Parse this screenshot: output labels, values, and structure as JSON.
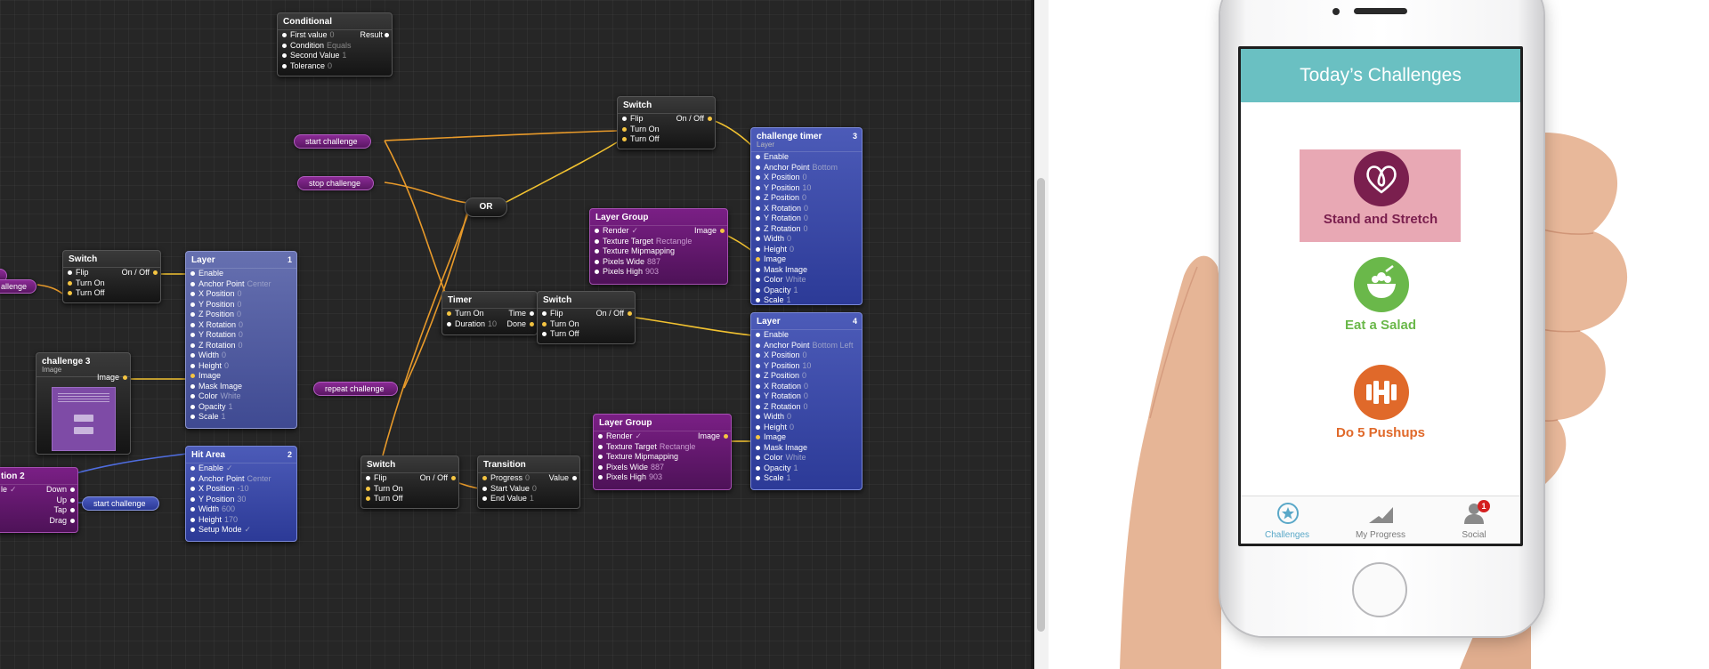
{
  "editor": {
    "nodes": {
      "conditional": {
        "title": "Conditional",
        "rows": [
          {
            "label": "First value",
            "value": "0"
          },
          {
            "label": "Condition",
            "value": "Equals"
          },
          {
            "label": "Second Value",
            "value": "1"
          },
          {
            "label": "Tolerance",
            "value": "0"
          }
        ],
        "output": "Result"
      },
      "switch_top": {
        "title": "Switch",
        "rows": [
          {
            "label": "Flip",
            "value": ""
          },
          {
            "label": "Turn On",
            "value": ""
          },
          {
            "label": "Turn Off",
            "value": ""
          }
        ],
        "output": "On / Off"
      },
      "challenge_timer": {
        "title": "challenge timer",
        "subtitle": "Layer",
        "index": "3",
        "rows": [
          {
            "label": "Enable",
            "value": ""
          },
          {
            "label": "Anchor Point",
            "value": "Bottom"
          },
          {
            "label": "X Position",
            "value": "0"
          },
          {
            "label": "Y Position",
            "value": "10"
          },
          {
            "label": "Z Position",
            "value": "0"
          },
          {
            "label": "X Rotation",
            "value": "0"
          },
          {
            "label": "Y Rotation",
            "value": "0"
          },
          {
            "label": "Z Rotation",
            "value": "0"
          },
          {
            "label": "Width",
            "value": "0"
          },
          {
            "label": "Height",
            "value": "0"
          },
          {
            "label": "Image",
            "value": ""
          },
          {
            "label": "Mask Image",
            "value": ""
          },
          {
            "label": "Color",
            "value": "White"
          },
          {
            "label": "Opacity",
            "value": "1"
          },
          {
            "label": "Scale",
            "value": "1"
          }
        ]
      },
      "layer_group_1": {
        "title": "Layer Group",
        "rows": [
          {
            "label": "Render",
            "value": "✓"
          },
          {
            "label": "Texture Target",
            "value": "Rectangle"
          },
          {
            "label": "Texture Mipmapping",
            "value": ""
          },
          {
            "label": "Pixels Wide",
            "value": "887"
          },
          {
            "label": "Pixels High",
            "value": "903"
          }
        ],
        "output": "Image"
      },
      "or": {
        "title": "OR"
      },
      "switch_left": {
        "title": "Switch",
        "rows": [
          {
            "label": "Flip",
            "value": ""
          },
          {
            "label": "Turn On",
            "value": ""
          },
          {
            "label": "Turn Off",
            "value": ""
          }
        ],
        "output": "On / Off"
      },
      "layer_1": {
        "title": "Layer",
        "index": "1",
        "rows": [
          {
            "label": "Enable",
            "value": ""
          },
          {
            "label": "Anchor Point",
            "value": "Center"
          },
          {
            "label": "X Position",
            "value": "0"
          },
          {
            "label": "Y Position",
            "value": "0"
          },
          {
            "label": "Z Position",
            "value": "0"
          },
          {
            "label": "X Rotation",
            "value": "0"
          },
          {
            "label": "Y Rotation",
            "value": "0"
          },
          {
            "label": "Z Rotation",
            "value": "0"
          },
          {
            "label": "Width",
            "value": "0"
          },
          {
            "label": "Height",
            "value": "0"
          },
          {
            "label": "Image",
            "value": ""
          },
          {
            "label": "Mask Image",
            "value": ""
          },
          {
            "label": "Color",
            "value": "White"
          },
          {
            "label": "Opacity",
            "value": "1"
          },
          {
            "label": "Scale",
            "value": "1"
          }
        ]
      },
      "timer": {
        "title": "Timer",
        "rows": [
          {
            "label": "Turn On",
            "value": ""
          },
          {
            "label": "Duration",
            "value": "10"
          }
        ],
        "outputs": [
          "Time",
          "Done"
        ]
      },
      "switch_mid": {
        "title": "Switch",
        "rows": [
          {
            "label": "Flip",
            "value": ""
          },
          {
            "label": "Turn On",
            "value": ""
          },
          {
            "label": "Turn Off",
            "value": ""
          }
        ],
        "output": "On / Off"
      },
      "layer_4": {
        "title": "Layer",
        "index": "4",
        "rows": [
          {
            "label": "Enable",
            "value": ""
          },
          {
            "label": "Anchor Point",
            "value": "Bottom Left"
          },
          {
            "label": "X Position",
            "value": "0"
          },
          {
            "label": "Y Position",
            "value": "10"
          },
          {
            "label": "Z Position",
            "value": "0"
          },
          {
            "label": "X Rotation",
            "value": "0"
          },
          {
            "label": "Y Rotation",
            "value": "0"
          },
          {
            "label": "Z Rotation",
            "value": "0"
          },
          {
            "label": "Width",
            "value": "0"
          },
          {
            "label": "Height",
            "value": "0"
          },
          {
            "label": "Image",
            "value": ""
          },
          {
            "label": "Mask Image",
            "value": ""
          },
          {
            "label": "Color",
            "value": "White"
          },
          {
            "label": "Opacity",
            "value": "1"
          },
          {
            "label": "Scale",
            "value": "1"
          }
        ]
      },
      "challenge_3": {
        "title": "challenge 3",
        "subtitle": "Image",
        "output": "Image"
      },
      "interaction_2": {
        "title": "tion 2",
        "rows": [
          {
            "label": "le",
            "value": "✓"
          },
          {
            "label": "",
            "value": ""
          },
          {
            "label": "",
            "value": ""
          },
          {
            "label": "",
            "value": ""
          }
        ],
        "outputs": [
          "Down",
          "Up",
          "Tap",
          "Drag"
        ]
      },
      "hit_area": {
        "title": "Hit Area",
        "index": "2",
        "rows": [
          {
            "label": "Enable",
            "value": "✓"
          },
          {
            "label": "Anchor Point",
            "value": "Center"
          },
          {
            "label": "X Position",
            "value": "-10"
          },
          {
            "label": "Y Position",
            "value": "30"
          },
          {
            "label": "Width",
            "value": "600"
          },
          {
            "label": "Height",
            "value": "170"
          },
          {
            "label": "Setup Mode",
            "value": "✓"
          }
        ]
      },
      "layer_group_2": {
        "title": "Layer Group",
        "rows": [
          {
            "label": "Render",
            "value": "✓"
          },
          {
            "label": "Texture Target",
            "value": "Rectangle"
          },
          {
            "label": "Texture Mipmapping",
            "value": ""
          },
          {
            "label": "Pixels Wide",
            "value": "887"
          },
          {
            "label": "Pixels High",
            "value": "903"
          }
        ],
        "output": "Image"
      },
      "switch_bottom": {
        "title": "Switch",
        "rows": [
          {
            "label": "Flip",
            "value": ""
          },
          {
            "label": "Turn On",
            "value": ""
          },
          {
            "label": "Turn Off",
            "value": ""
          }
        ],
        "output": "On / Off"
      },
      "transition": {
        "title": "Transition",
        "rows": [
          {
            "label": "Progress",
            "value": "0"
          },
          {
            "label": "Start Value",
            "value": "0"
          },
          {
            "label": "End Value",
            "value": "1"
          }
        ],
        "output": "Value"
      }
    },
    "pills": {
      "start_challenge": "start challenge",
      "stop_challenge": "stop challenge",
      "repeat_challenge": "repeat challenge",
      "start_challenge_2": "start challenge",
      "edge_1": "",
      "edge_2": "allenge"
    }
  },
  "app": {
    "header": "Today’s Challenges",
    "challenges": [
      {
        "label": "Stand and Stretch",
        "color": "#7a1f4e",
        "bg": "#e8a8b4",
        "icon": "heart-loop-icon"
      },
      {
        "label": "Eat a Salad",
        "color": "#6ab84a",
        "icon": "salad-bowl-icon"
      },
      {
        "label": "Do 5 Pushups",
        "color": "#e0692a",
        "icon": "dumbbell-icon"
      }
    ],
    "tabs": [
      {
        "label": "Challenges",
        "icon": "star-badge-icon",
        "active": true
      },
      {
        "label": "My Progress",
        "icon": "progress-chart-icon"
      },
      {
        "label": "Social",
        "icon": "person-icon",
        "badge": "1"
      }
    ]
  }
}
